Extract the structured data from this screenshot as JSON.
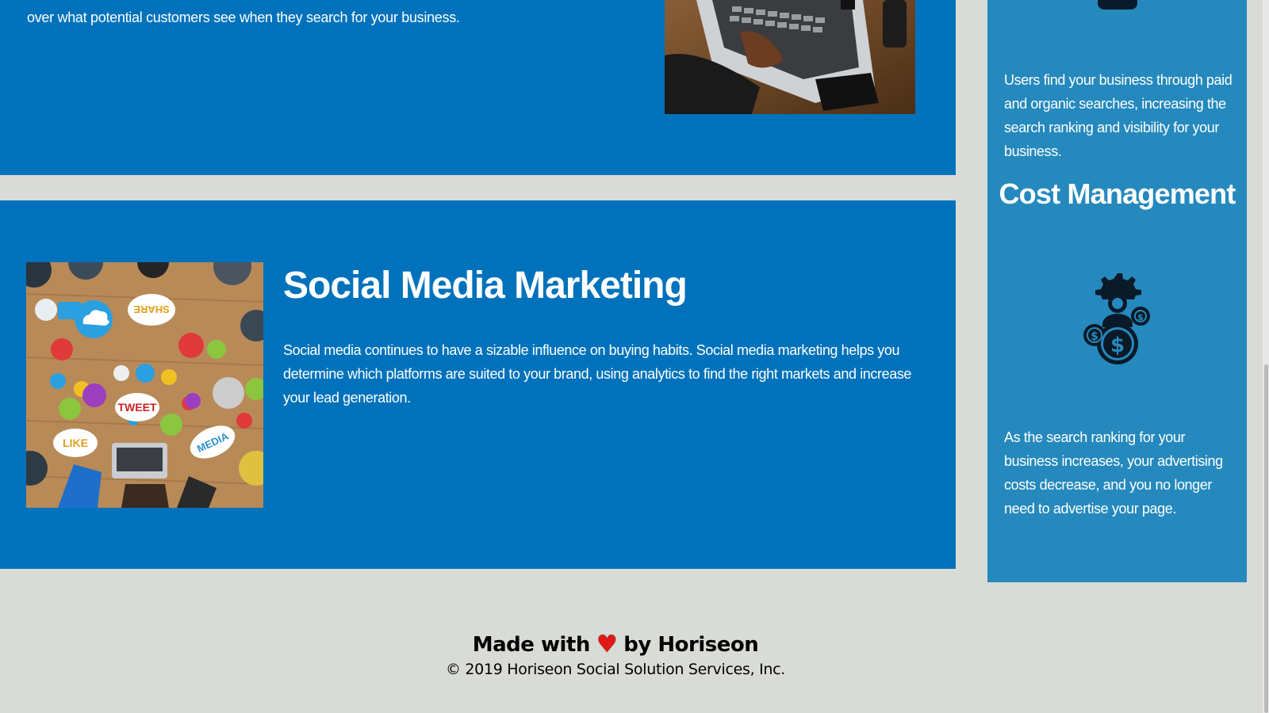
{
  "intro": {
    "text_tail": "over what potential customers see when they search for your business."
  },
  "social_media_marketing": {
    "title": "Social Media Marketing",
    "body": "Social media continues to have a sizable influence on buying habits. Social media marketing helps you determine which platforms are suited to your brand, using analytics to find the right markets and increase your lead generation.",
    "image_stickers": [
      "SHARE",
      "TWEET",
      "LIKE",
      "MEDIA"
    ]
  },
  "sidebar": {
    "paragraph_1": "Users find your business through paid and organic searches, increasing the search ranking and visibility for your business.",
    "cost_title": "Cost Management",
    "paragraph_2": "As the search ranking for your business increases, your advertising costs decrease, and you no longer need to advertise your page."
  },
  "footer": {
    "made_with": "Made with",
    "by": "by Horiseon",
    "heart_glyph": "♥",
    "copyright": "© 2019 Horiseon Social Solution Services, Inc."
  },
  "colors": {
    "page_bg": "#d9dcd6",
    "card_bg": "#0072bb",
    "sidebar_bg": "#2589bd",
    "heart": "#e01818"
  }
}
